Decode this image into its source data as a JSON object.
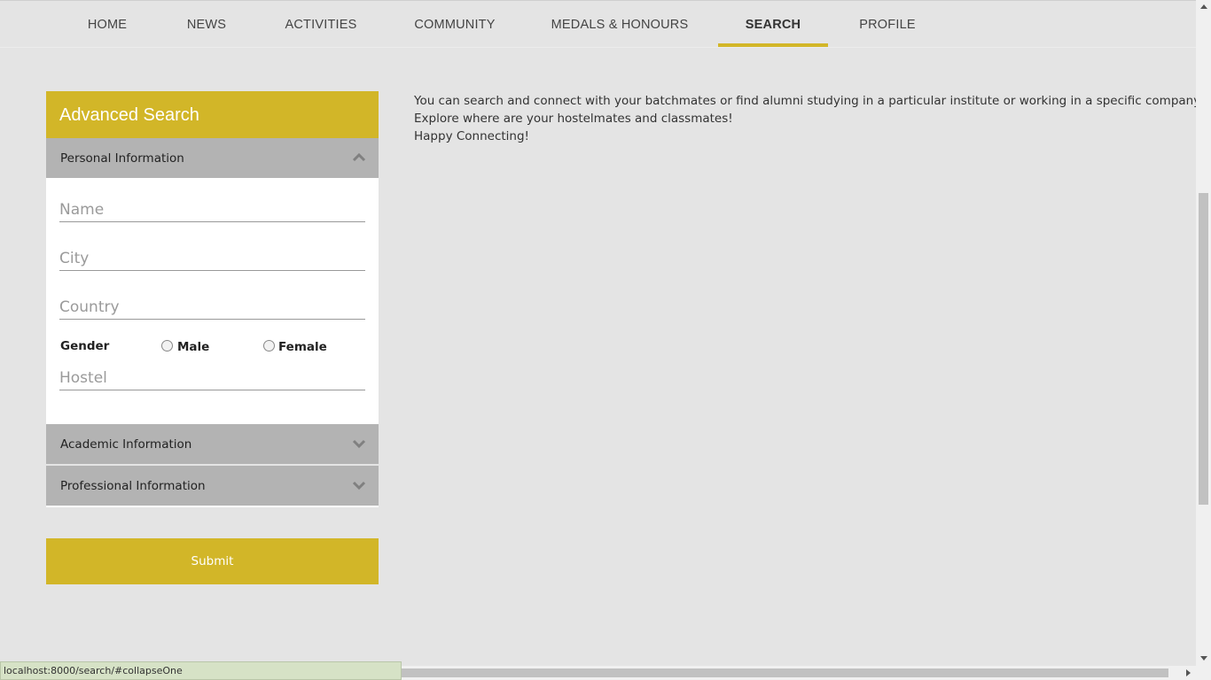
{
  "nav": {
    "items": [
      {
        "label": "HOME"
      },
      {
        "label": "NEWS"
      },
      {
        "label": "ACTIVITIES"
      },
      {
        "label": "COMMUNITY"
      },
      {
        "label": "MEDALS & HONOURS"
      },
      {
        "label": "SEARCH"
      },
      {
        "label": "PROFILE"
      }
    ],
    "active": "SEARCH",
    "accent_color": "#d2b628"
  },
  "search_panel": {
    "title": "Advanced Search",
    "personal": {
      "heading": "Personal Information",
      "state_icon": "chevron-up-icon",
      "fields": {
        "name_placeholder": "Name",
        "city_placeholder": "City",
        "country_placeholder": "Country",
        "hostel_placeholder": "Hostel"
      },
      "gender": {
        "label": "Gender",
        "options": [
          "Male",
          "Female"
        ]
      }
    },
    "academic": {
      "heading": "Academic Information",
      "state_icon": "chevron-down-icon"
    },
    "professional": {
      "heading": "Professional Information",
      "state_icon": "chevron-down-icon"
    },
    "submit_label": "Submit"
  },
  "info": {
    "lines": [
      "You can search and connect with your batchmates or find alumni studying in a particular institute or working in a specific company.",
      "Explore where are your hostelmates and classmates!",
      "Happy Connecting!"
    ]
  },
  "status_bar": {
    "url": "localhost:8000/search/#collapseOne"
  }
}
